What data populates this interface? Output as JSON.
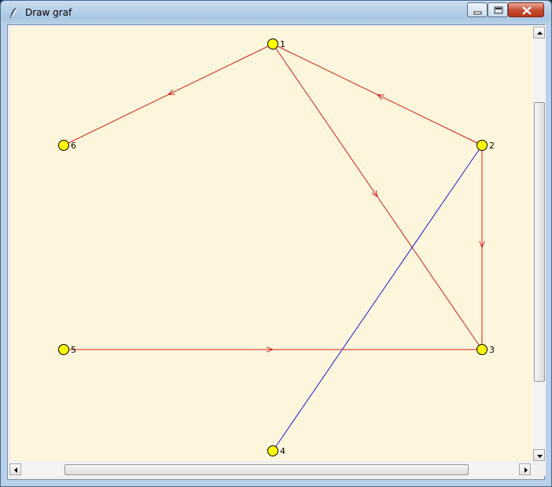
{
  "window": {
    "title": "Draw graf",
    "icon": "feather-icon"
  },
  "graph": {
    "nodes": [
      {
        "id": "1",
        "label": "1"
      },
      {
        "id": "2",
        "label": "2"
      },
      {
        "id": "3",
        "label": "3"
      },
      {
        "id": "4",
        "label": "4"
      },
      {
        "id": "5",
        "label": "5"
      },
      {
        "id": "6",
        "label": "6"
      }
    ],
    "edges": [
      {
        "from": "1",
        "to": "6",
        "color": "#d42020",
        "directed": true
      },
      {
        "from": "2",
        "to": "1",
        "color": "#d42020",
        "directed": true
      },
      {
        "from": "1",
        "to": "3",
        "color": "#d42020",
        "directed": true
      },
      {
        "from": "2",
        "to": "3",
        "color": "#d42020",
        "directed": true
      },
      {
        "from": "5",
        "to": "3",
        "color": "#d42020",
        "directed": true
      },
      {
        "from": "2",
        "to": "4",
        "color": "#1a1ad6",
        "directed": false
      }
    ],
    "node_fill": "#ffff00",
    "canvas_bg": "#fef6dc"
  }
}
